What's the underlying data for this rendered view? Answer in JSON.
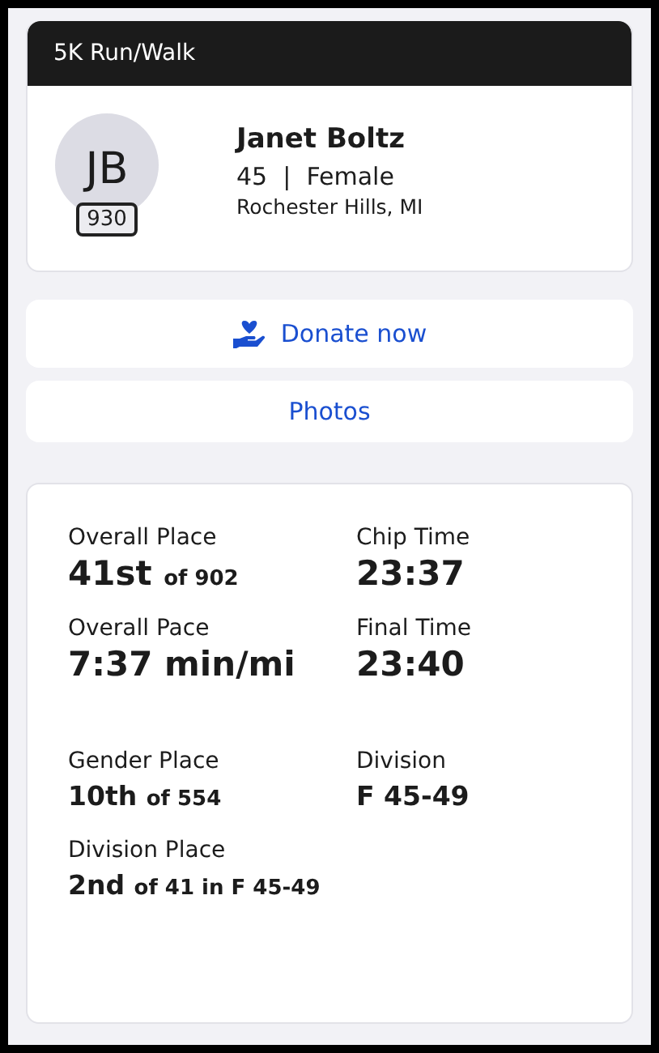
{
  "event": {
    "title": "5K Run/Walk"
  },
  "participant": {
    "initials": "JB",
    "bib": "930",
    "name": "Janet Boltz",
    "age": "45",
    "separator": "|",
    "gender": "Female",
    "location": "Rochester Hills, MI"
  },
  "actions": [
    {
      "kind": "donate",
      "label": "Donate now"
    },
    {
      "kind": "plain",
      "label": "Photos"
    }
  ],
  "results": {
    "primary": [
      {
        "label": "Overall Place",
        "value": "41st",
        "detail": "of 902"
      },
      {
        "label": "Chip Time",
        "value": "23:37"
      },
      {
        "label": "Overall Pace",
        "value": "7:37 min/mi"
      },
      {
        "label": "Final Time",
        "value": "23:40"
      }
    ],
    "secondary": [
      {
        "label": "Gender Place",
        "value": "10th",
        "detail": "of 554"
      },
      {
        "label": "Division",
        "value": "F 45-49"
      },
      {
        "label": "Division Place",
        "value": "2nd",
        "detail": "of 41 in F 45-49"
      }
    ]
  }
}
